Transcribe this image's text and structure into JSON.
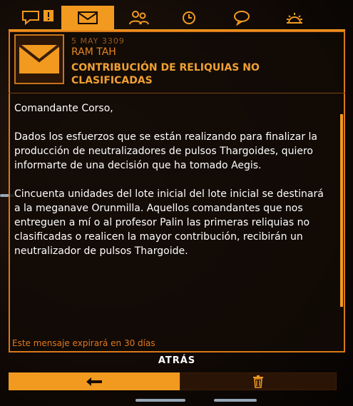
{
  "tabs": [
    {
      "name": "tab-chat",
      "icon": "chat-alert-icon"
    },
    {
      "name": "tab-inbox",
      "icon": "envelope-icon"
    },
    {
      "name": "tab-contacts",
      "icon": "contacts-icon"
    },
    {
      "name": "tab-history",
      "icon": "clock-icon"
    },
    {
      "name": "tab-comms",
      "icon": "speech-bubble-icon"
    },
    {
      "name": "tab-settings",
      "icon": "gear-icon"
    }
  ],
  "message": {
    "date": "5 MAY 3309",
    "sender": "RAM TAH",
    "subject": "CONTRIBUCIÓN DE RELIQUIAS NO CLASIFICADAS",
    "greeting": "Comandante Corso,",
    "paragraph1": "Dados los esfuerzos que se están realizando para finalizar la producción de neutralizadores de pulsos Thargoides, quiero informarte de una decisión que ha tomado Aegis.",
    "paragraph2": "Cincuenta unidades del lote inicial del lote inicial se destinará a la meganave Orunmilla. Aquellos comandantes que nos entreguen a mí o al profesor Palin las primeras reliquias no clasificadas o realicen la mayor contribución, recibirán un neutralizador de pulsos Thargoide.",
    "expiry": "Este mensaje expirará en 30 días"
  },
  "footer": {
    "back_label": "ATRÁS",
    "back_icon": "back-arrow-icon",
    "delete_icon": "trash-icon"
  },
  "colors": {
    "accent": "#f19a1f",
    "text": "#ffffff",
    "dim": "#9a5a1a"
  }
}
